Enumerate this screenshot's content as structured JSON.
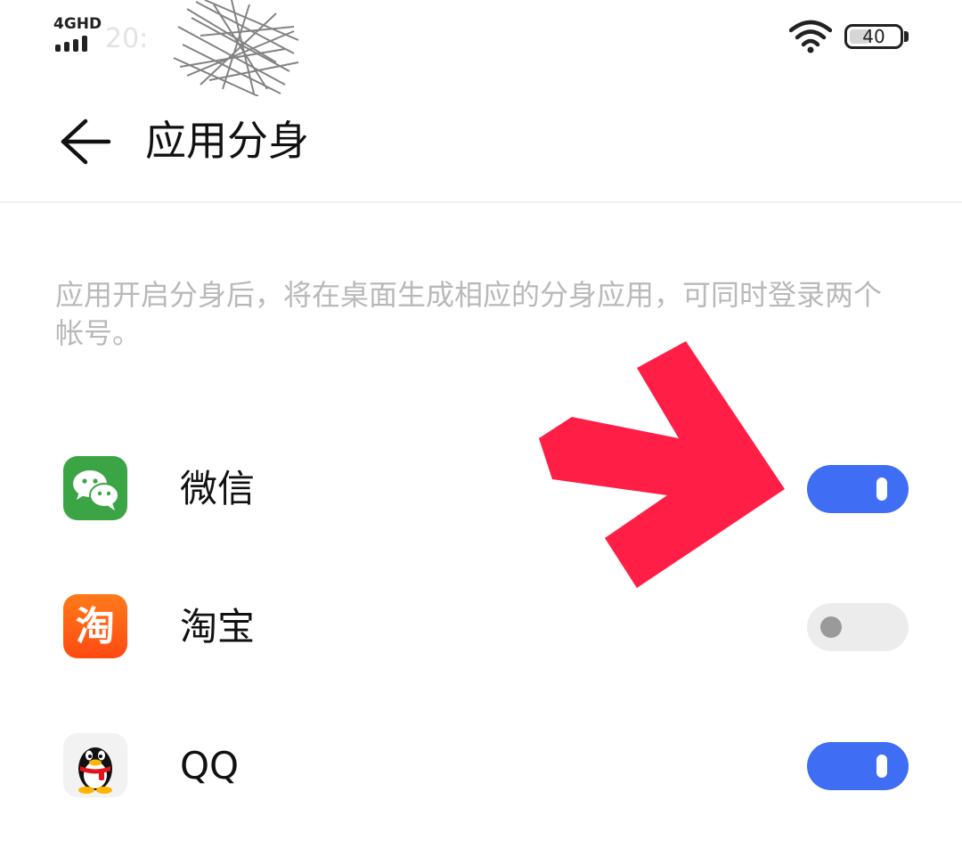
{
  "status_bar": {
    "network": "4GHD",
    "time": "20:",
    "battery_level": "40",
    "battery_fraction": 0.4
  },
  "header": {
    "title": "应用分身"
  },
  "description": "应用开启分身后，将在桌面生成相应的分身应用，可同时登录两个帐号。",
  "apps": [
    {
      "name": "微信",
      "icon": "wechat-icon",
      "enabled": true
    },
    {
      "name": "淘宝",
      "icon": "taobao-icon",
      "icon_glyph": "淘",
      "enabled": false
    },
    {
      "name": "QQ",
      "icon": "qq-icon",
      "enabled": true
    }
  ],
  "colors": {
    "toggle_on": "#3f6ef4",
    "toggle_off": "#ececec",
    "annotation_arrow": "#ff1e46",
    "description_text": "#b9b9b9",
    "wechat_green": "#3ba545",
    "taobao_orange": "#ff5a16"
  }
}
